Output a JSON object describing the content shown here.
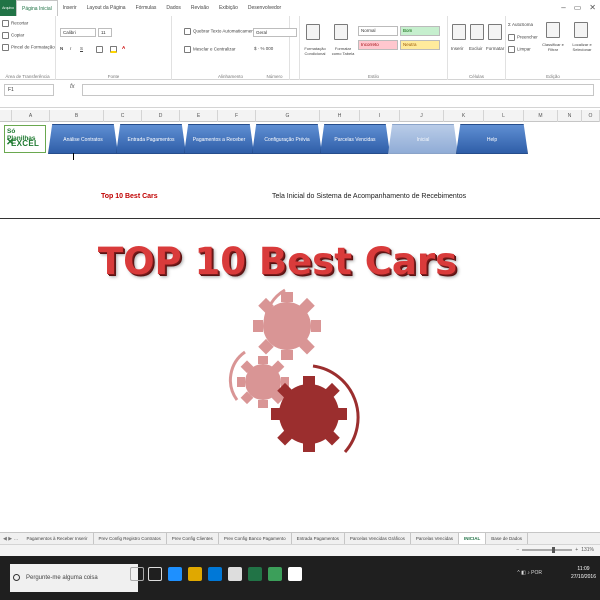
{
  "ribbon_tabs": [
    "Arquivo",
    "Página Inicial",
    "Inserir",
    "Layout da Página",
    "Fórmulas",
    "Dados",
    "Revisão",
    "Exibição",
    "Desenvolvedor"
  ],
  "ribbon": {
    "clipboard": {
      "paste": "Colar",
      "cut": "Recortar",
      "copy": "Copiar",
      "format_painter": "Pincel de Formatação",
      "label": "Área de Transferência"
    },
    "font": {
      "name": "Calibri",
      "size": "11",
      "label": "Fonte"
    },
    "alignment": {
      "wrap": "Quebrar Texto Automaticamente",
      "merge": "Mesclar e Centralizar",
      "label": "Alinhamento"
    },
    "number": {
      "format": "Geral",
      "label": "Número"
    },
    "styles": {
      "conditional": "Formatação Condicional",
      "as_table": "Formatar como Tabela",
      "normal": "Normal",
      "good": "Bom",
      "bad": "Incorreto",
      "neutral": "Neutra",
      "label": "Estilo"
    },
    "cells": {
      "insert": "Inserir",
      "delete": "Excluir",
      "format": "Formatar",
      "label": "Células"
    },
    "editing": {
      "autosum": "AutoSoma",
      "fill": "Preencher",
      "clear": "Limpar",
      "sort": "Classificar e Filtrar",
      "find": "Localizar e Selecionar",
      "label": "Edição"
    }
  },
  "formula_bar": {
    "name_box": "F1",
    "fx": "fx"
  },
  "columns": [
    "A",
    "B",
    "C",
    "D",
    "E",
    "F",
    "G",
    "H",
    "I",
    "J",
    "K",
    "L",
    "M",
    "N",
    "O"
  ],
  "logo": {
    "line1": "Só Planilhas",
    "line2": "EXCEL"
  },
  "nav_buttons": [
    "Análise Contratos",
    "Entrada Pagamentos",
    "Pagamentos a Receber",
    "Configuração Prévia",
    "Parcelas Vencidas",
    "Inicial",
    "Help"
  ],
  "sheet": {
    "subtitle_left": "Top 10 Best Cars",
    "subtitle_right": "Tela Inicial do Sistema de Acompanhamento de Recebimentos",
    "big_title": "TOP 10 Best Cars"
  },
  "sheet_tabs": [
    "Pagamentos à Receber Inserir",
    "Prev Config Registro Contratos",
    "Prev Config Clientes",
    "Prev Config Banco Pagamento",
    "Entrada Pagamentos",
    "Parcelas Vencidas Gráficos",
    "Parcelas Vencidas",
    "INICIAL",
    "Base de Dados"
  ],
  "status": {
    "zoom": "131%"
  },
  "taskbar": {
    "search_placeholder": "Pergunte-me alguma coisa",
    "time": "11:09",
    "date": "27/10/2016",
    "lang": "POR"
  },
  "colors": {
    "excel_green": "#217346",
    "nav_blue": "#2f5ea8",
    "title_red": "#d93b3b",
    "gear_dark": "#9b2e2e",
    "gear_light": "#d99595"
  }
}
